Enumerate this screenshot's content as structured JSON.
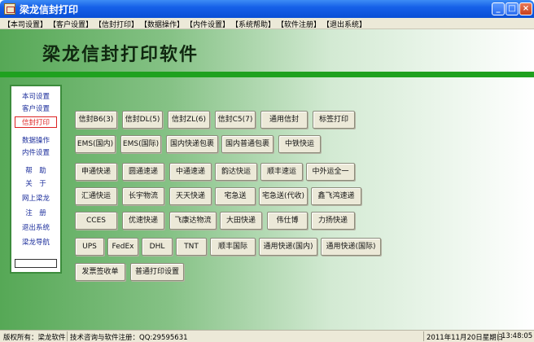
{
  "window": {
    "title": "梁龙信封打印"
  },
  "menu": [
    "【本司设置】",
    "【客户设置】",
    "【信封打印】",
    "【数据操作】",
    "【内件设置】",
    "【系统帮助】",
    "【软件注册】",
    "【退出系统】"
  ],
  "banner": {
    "title": "梁龙信封打印软件"
  },
  "sidebar": {
    "items": [
      "本司设置",
      "客户设置",
      "信封打印",
      "数据操作",
      "内件设置",
      "帮　助",
      "关　于",
      "网上梁龙",
      "注　册",
      "退出系统",
      "梁龙导航"
    ],
    "active_index": 2,
    "input_value": ""
  },
  "buttons": {
    "row1": [
      "信封B6(3)",
      "信封DL(5)",
      "信封ZL(6)",
      "信封C5(7)",
      "通用信封",
      "标签打印"
    ],
    "row2": [
      "EMS(国内)",
      "EMS(国际)",
      "国内快递包裹",
      "国内普通包裹",
      "中铁快运"
    ],
    "row3": [
      "申通快递",
      "圆通速递",
      "中通速递",
      "韵达快运",
      "顺丰速运",
      "中外运全一"
    ],
    "row4": [
      "汇通快运",
      "长宇物流",
      "天天快递",
      "宅急送",
      "宅急送(代收)",
      "鑫飞鸿速递"
    ],
    "row5": [
      "CCES",
      "优速快递",
      "飞康达物流",
      "大田快递",
      "伟仕博",
      "力扬快递"
    ],
    "row6": [
      "UPS",
      "FedEx",
      "DHL",
      "TNT",
      "顺丰国际",
      "通用快递(国内)",
      "通用快递(国际)"
    ],
    "row7": [
      "发票签收单",
      "普通打印设置"
    ]
  },
  "status": {
    "copyright": "版权所有：梁龙软件",
    "contact": "技术咨询与软件注册：QQ:29595631",
    "date": "2011年11月20日星期日",
    "time": "13:48:05"
  },
  "colors": {
    "title_bar": "#0a4fd6",
    "stripe": "#1fa11f",
    "sidebar_text": "#1d2f9c",
    "active": "#d22"
  }
}
